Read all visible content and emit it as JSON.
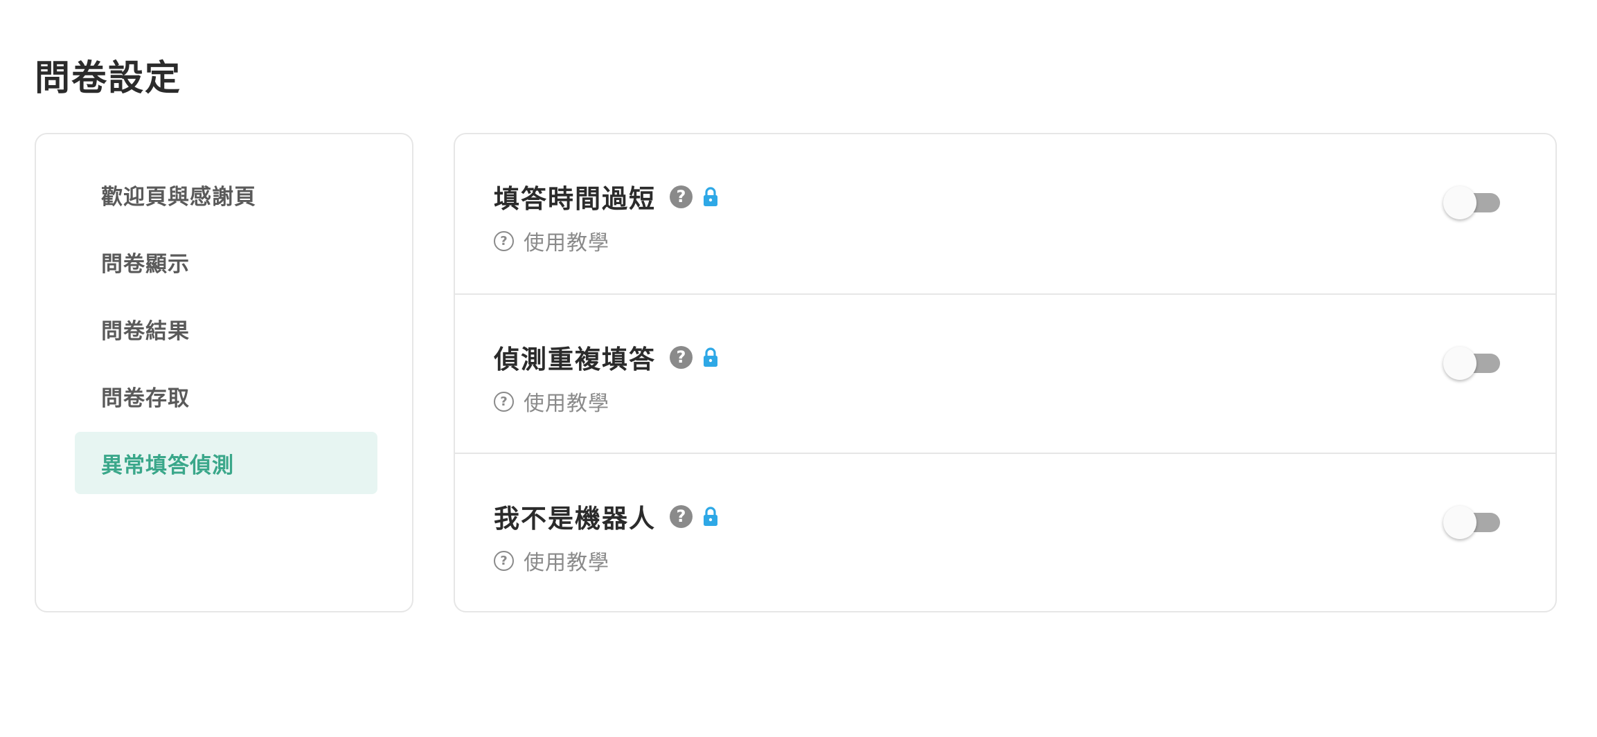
{
  "page": {
    "title": "問卷設定"
  },
  "sidebar": {
    "items": [
      {
        "label": "歡迎頁與感謝頁",
        "active": false
      },
      {
        "label": "問卷顯示",
        "active": false
      },
      {
        "label": "問卷結果",
        "active": false
      },
      {
        "label": "問卷存取",
        "active": false
      },
      {
        "label": "異常填答偵測",
        "active": true
      }
    ]
  },
  "settings": {
    "rows": [
      {
        "title": "填答時間過短",
        "help_icon": "question-circle-icon",
        "lock_icon": "lock-icon",
        "tutorial_label": "使用教學",
        "enabled": false
      },
      {
        "title": "偵測重複填答",
        "help_icon": "question-circle-icon",
        "lock_icon": "lock-icon",
        "tutorial_label": "使用教學",
        "enabled": false
      },
      {
        "title": "我不是機器人",
        "help_icon": "question-circle-icon",
        "lock_icon": "lock-icon",
        "tutorial_label": "使用教學",
        "enabled": false
      }
    ]
  },
  "colors": {
    "accent": "#3aa78a",
    "active_bg": "#e7f5f2",
    "lock": "#2ea8e6",
    "toggle_off": "#a8a8a8",
    "muted_text": "#8a8a8a"
  }
}
